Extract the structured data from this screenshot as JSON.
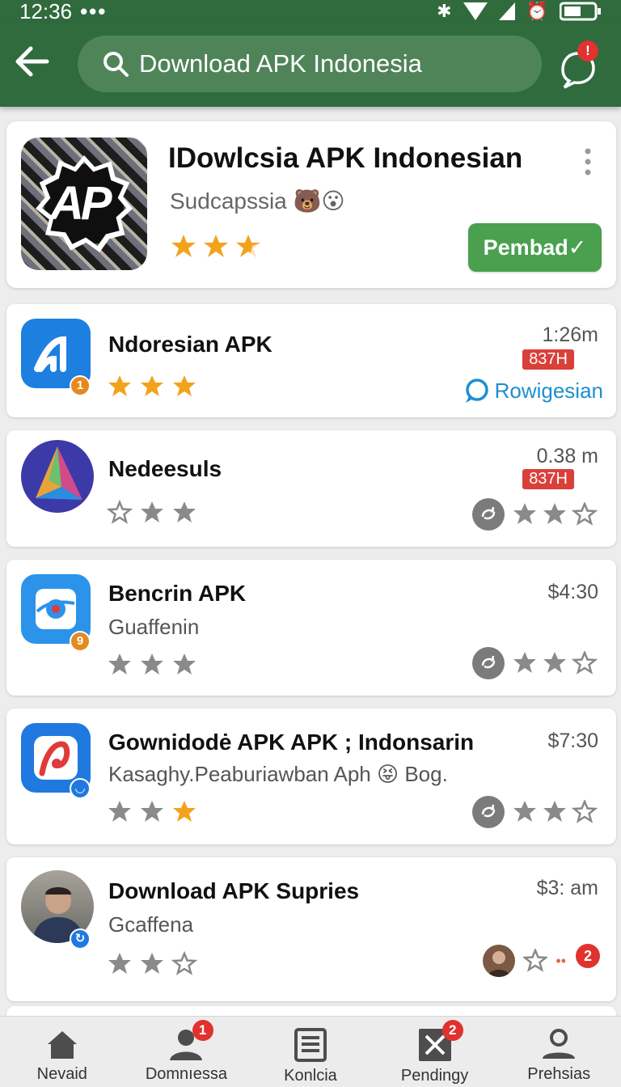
{
  "status_bar": {
    "time": "12:36",
    "dots": "•••"
  },
  "header": {
    "search_text": "Download APK Indonesia",
    "chat_badge": "!"
  },
  "featured": {
    "title": "IDowlcsia APK Indonesian",
    "subtitle": "Sudcapssia",
    "subtitle_emojis": "🐻😮",
    "icon_text": "AP",
    "rating": 2.5,
    "download_label": "Pembad✓"
  },
  "items": [
    {
      "name": "Ndoresian APK",
      "time": "1:26m",
      "tag": "837H",
      "reviews": "Rowigesian",
      "rating": 3,
      "icon_badge": "1"
    },
    {
      "name": "Nedeesuls",
      "time": "0.38  m",
      "tag": "837H",
      "rating": 0
    },
    {
      "name": "Bencrin APK",
      "desc": "Guaffenin",
      "time": "$4:30",
      "rating": 0,
      "icon_badge": "9"
    },
    {
      "name": "Gownidodė APK APK ; Indonsarin",
      "desc": "Kasaghy.Peaburiawban Aph",
      "desc_emoji": "😝",
      "desc_tail": "Bog.",
      "time": "$7:30",
      "rating": 1
    },
    {
      "name": "Download APK Supries",
      "desc": "Gcaffena",
      "time": "$3: am",
      "rating": 0,
      "action_badge": "2"
    }
  ],
  "bottom_nav": [
    {
      "label": "Nevaid",
      "icon": "home-icon"
    },
    {
      "label": "Domnıessa",
      "icon": "person-icon",
      "badge": "1"
    },
    {
      "label": "Konlcia",
      "icon": "list-icon"
    },
    {
      "label": "Pendingy",
      "icon": "close-box-icon",
      "badge": "2"
    },
    {
      "label": "Prehsias",
      "icon": "profile-icon"
    }
  ],
  "colors": {
    "header": "#2f6b3d",
    "accent": "#4aa04e",
    "star": "#f2a31b",
    "tag": "#d9403a",
    "link": "#1d8fd0"
  }
}
